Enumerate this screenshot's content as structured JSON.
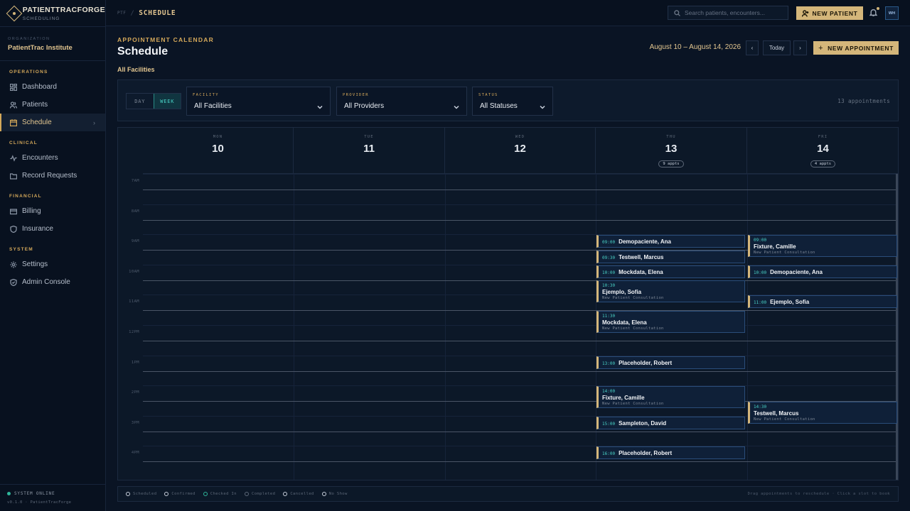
{
  "brand": {
    "name": "PATIENTTRACFORGE",
    "sub": "SCHEDULING"
  },
  "org": {
    "label": "ORGANIZATION",
    "name": "PatientTrac Institute"
  },
  "nav": {
    "operations_label": "OPERATIONS",
    "dashboard": "Dashboard",
    "patients": "Patients",
    "schedule": "Schedule",
    "clinical_label": "CLINICAL",
    "encounters": "Encounters",
    "record_requests": "Record Requests",
    "financial_label": "FINANCIAL",
    "billing": "Billing",
    "insurance": "Insurance",
    "system_label": "SYSTEM",
    "settings": "Settings",
    "admin_console": "Admin Console"
  },
  "system": {
    "status": "SYSTEM ONLINE",
    "version": "v0.1.0 · PatientTracForge"
  },
  "topbar": {
    "crumb_root": "PTF",
    "crumb_sep": "/",
    "crumb_current": "SCHEDULE",
    "search_placeholder": "Search patients, encounters...",
    "new_patient": "NEW PATIENT",
    "avatar": "WH"
  },
  "header": {
    "eyebrow": "APPOINTMENT CALENDAR",
    "title": "Schedule",
    "filter_label": "All Facilities",
    "date_range": "August 10 – August 14, 2026",
    "prev": "‹",
    "today": "Today",
    "next": "›",
    "new_appointment": "NEW APPOINTMENT",
    "plus": "+"
  },
  "filters": {
    "view_day": "DAY",
    "view_week": "WEEK",
    "facility_label": "FACILITY",
    "facility_value": "All Facilities",
    "provider_label": "PROVIDER",
    "provider_value": "All Providers",
    "status_label": "STATUS",
    "status_value": "All Statuses",
    "count": "13 appointments"
  },
  "calendar": {
    "hours": [
      "7AM",
      "8AM",
      "9AM",
      "10AM",
      "11AM",
      "12PM",
      "1PM",
      "2PM",
      "3PM",
      "4PM"
    ],
    "days": [
      {
        "name": "MON",
        "num": "10",
        "badge": ""
      },
      {
        "name": "TUE",
        "num": "11",
        "badge": ""
      },
      {
        "name": "WED",
        "num": "12",
        "badge": ""
      },
      {
        "name": "THU",
        "num": "13",
        "badge": "9 appts"
      },
      {
        "name": "FRI",
        "num": "14",
        "badge": "4 appts"
      }
    ],
    "appointments": [
      {
        "day": 3,
        "start": "09:00",
        "time": "09:00",
        "name": "Demopaciente, Ana",
        "type": ""
      },
      {
        "day": 3,
        "start": "09:30",
        "time": "09:30",
        "name": "Testwell, Marcus",
        "type": ""
      },
      {
        "day": 3,
        "start": "10:00",
        "time": "10:00",
        "name": "Mockdata, Elena",
        "type": ""
      },
      {
        "day": 3,
        "start": "10:30",
        "time": "10:30",
        "name": "Ejemplo, Sofia",
        "type": "New Patient Consultation"
      },
      {
        "day": 3,
        "start": "11:30",
        "time": "11:30",
        "name": "Mockdata, Elena",
        "type": "New Patient Consultation"
      },
      {
        "day": 3,
        "start": "13:00",
        "time": "13:00",
        "name": "Placeholder, Robert",
        "type": ""
      },
      {
        "day": 3,
        "start": "14:00",
        "time": "14:00",
        "name": "Fixture, Camille",
        "type": "New Patient Consultation"
      },
      {
        "day": 3,
        "start": "15:00",
        "time": "15:00",
        "name": "Sampleton, David",
        "type": ""
      },
      {
        "day": 3,
        "start": "16:00",
        "time": "16:00",
        "name": "Placeholder, Robert",
        "type": ""
      },
      {
        "day": 4,
        "start": "09:00",
        "time": "09:00",
        "name": "Fixture, Camille",
        "type": "New Patient Consultation"
      },
      {
        "day": 4,
        "start": "10:00",
        "time": "10:00",
        "name": "Demopaciente, Ana",
        "type": ""
      },
      {
        "day": 4,
        "start": "11:00",
        "time": "11:00",
        "name": "Ejemplo, Sofia",
        "type": ""
      },
      {
        "day": 4,
        "start": "14:30",
        "time": "14:30",
        "name": "Testwell, Marcus",
        "type": "New Patient Consultation"
      }
    ]
  },
  "legend": {
    "items": [
      "Scheduled",
      "Confirmed",
      "Checked In",
      "Completed",
      "Cancelled",
      "No Show"
    ],
    "colors": [
      "#c8cfdb",
      "#c8cfdb",
      "#2fb59a",
      "#5d6878",
      "#c8cfdb",
      "#c8cfdb"
    ],
    "hint": "Drag appointments to reschedule · Click a slot to book"
  },
  "colors": {
    "accent": "#d4b67a",
    "teal": "#49d2c6",
    "background": "#0a1424"
  }
}
